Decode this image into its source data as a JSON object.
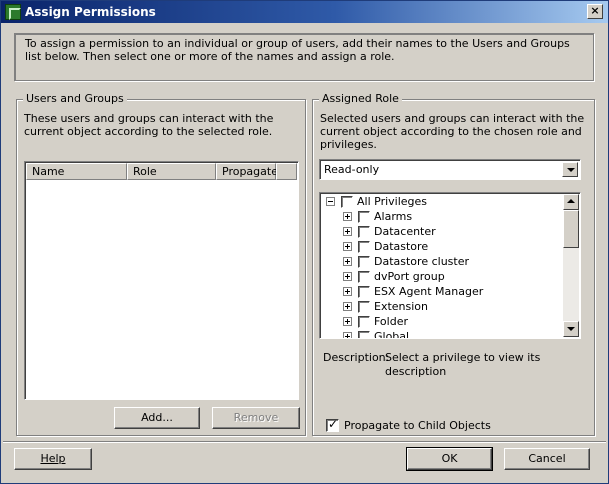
{
  "window": {
    "title": "Assign Permissions",
    "close_glyph": "×"
  },
  "intro": {
    "text": "To assign a permission to an individual or group of users, add their names to the Users and Groups list below. Then select one or more of the names and assign a role."
  },
  "users_groups": {
    "legend": "Users and Groups",
    "description": "These users and groups can interact with the current object according to the selected role.",
    "columns": [
      "Name",
      "Role",
      "Propagate"
    ],
    "add_label": "Add...",
    "remove_label": "Remove"
  },
  "assigned_role": {
    "legend": "Assigned Role",
    "description": "Selected users and groups can interact with the current object according to the chosen role and privileges.",
    "role_selected": "Read-only",
    "privileges": [
      "All Privileges",
      "Alarms",
      "Datacenter",
      "Datastore",
      "Datastore cluster",
      "dvPort group",
      "ESX Agent Manager",
      "Extension",
      "Folder",
      "Global"
    ],
    "description_label": "Description:",
    "description_value": "Select a privilege to view its description",
    "propagate_label": "Propagate to Child Objects",
    "propagate_checked": true,
    "check_glyph": "✓"
  },
  "footer": {
    "help_label": "Help",
    "ok_label": "OK",
    "cancel_label": "Cancel"
  },
  "icons": {
    "app": "vsphere-client-icon",
    "close": "close-icon",
    "dropdown": "chevron-down-icon"
  }
}
